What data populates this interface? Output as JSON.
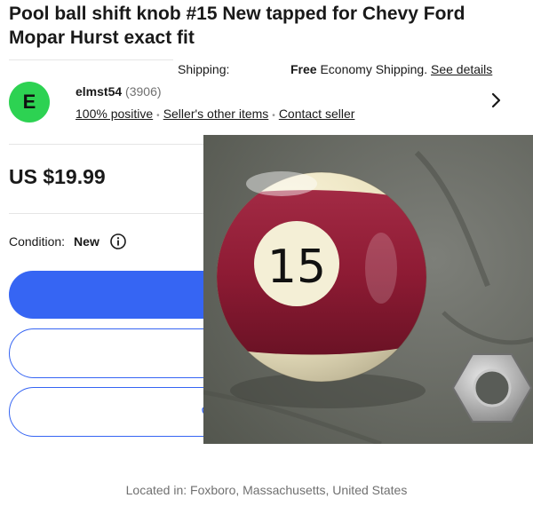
{
  "listing": {
    "title": "Pool ball shift knob #15 New tapped for Chevy Ford Mopar Hurst exact fit",
    "price": "US $19.99",
    "condition_label": "Condition:",
    "condition_value": "New",
    "location": "Located in: Foxboro, Massachusetts, United States",
    "photo_ball_number": "15"
  },
  "shipping": {
    "label": "Shipping:",
    "free": "Free",
    "method": "Economy Shipping.",
    "details_link": "See details"
  },
  "seller": {
    "avatar_letter": "E",
    "name": "elmst54",
    "feedback_count": "(3906)",
    "positive": "100% positive",
    "other_items": "Seller's other items",
    "contact": "Contact seller"
  },
  "colors": {
    "avatar_bg": "#2dd252",
    "primary_button": "#3665f3",
    "ball_stripe": "#8e1b34"
  },
  "icons": [
    "chevron-right-icon",
    "info-icon",
    "heart-icon"
  ]
}
